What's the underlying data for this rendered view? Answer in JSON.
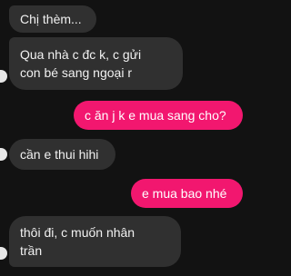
{
  "messages": [
    {
      "sender": "contact",
      "text": "Chị thèm..."
    },
    {
      "sender": "contact",
      "lines": [
        "Qua nhà c đc k, c gửi",
        "con bé sang ngoại r"
      ]
    },
    {
      "sender": "me",
      "text": "c ăn j k e mua sang cho?"
    },
    {
      "sender": "contact",
      "text": "cần e thui hihi"
    },
    {
      "sender": "me",
      "text": "e mua bao nhé"
    },
    {
      "sender": "contact",
      "lines": [
        "thôi đi, c muốn nhân",
        "trần"
      ]
    }
  ],
  "colors": {
    "background": "#121212",
    "incoming_bubble": "#303030",
    "outgoing_bubble": "#f2176f"
  }
}
